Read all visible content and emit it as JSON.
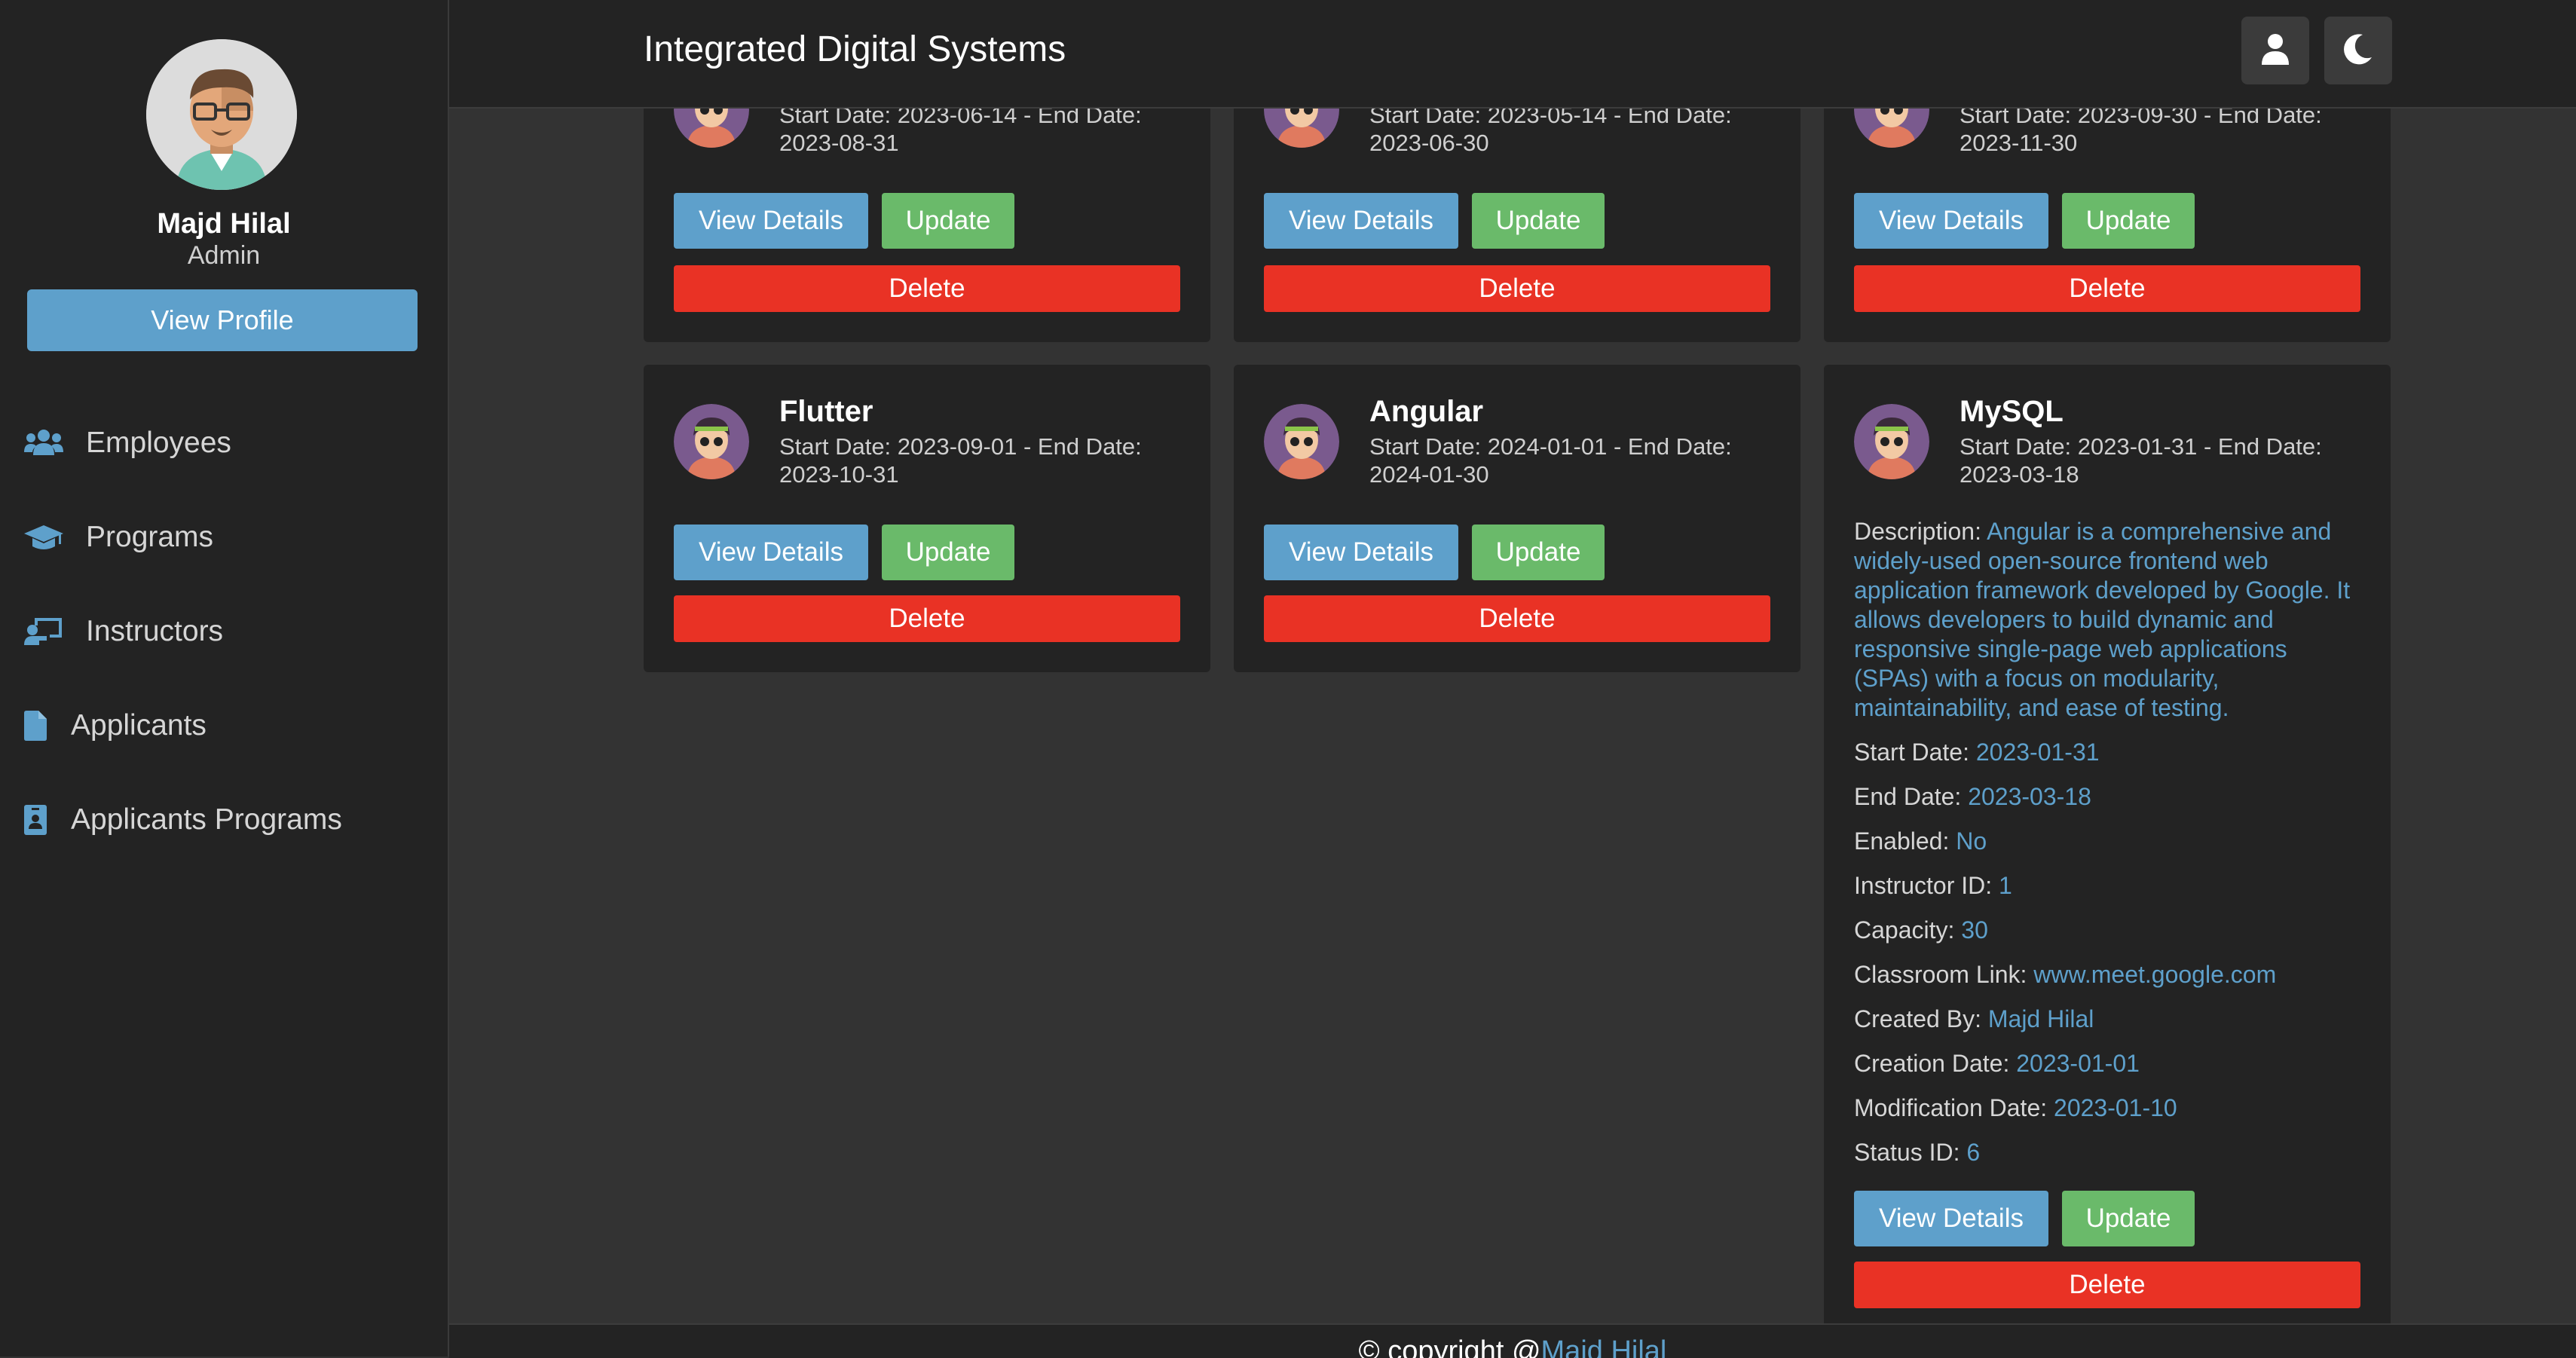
{
  "sidebar": {
    "user_name": "Majd Hilal",
    "user_role": "Admin",
    "view_profile_label": "View Profile",
    "items": [
      {
        "label": "Employees",
        "icon": "users-icon"
      },
      {
        "label": "Programs",
        "icon": "graduation-cap-icon"
      },
      {
        "label": "Instructors",
        "icon": "chalkboard-teacher-icon"
      },
      {
        "label": "Applicants",
        "icon": "file-icon"
      },
      {
        "label": "Applicants Programs",
        "icon": "id-badge-icon"
      }
    ]
  },
  "header": {
    "title": "Integrated Digital Systems",
    "icons": [
      "user-icon",
      "moon-icon"
    ]
  },
  "buttons": {
    "view_details": "View Details",
    "update": "Update",
    "delete": "Delete"
  },
  "cards_top": [
    {
      "dates_line1": "Start Date: 2023-06-14 - End Date:",
      "dates_line2": "2023-08-31"
    },
    {
      "dates_line1": "Start Date: 2023-05-14 - End Date:",
      "dates_line2": "2023-06-30"
    },
    {
      "dates_line1": "Start Date: 2023-09-30 - End Date:",
      "dates_line2": "2023-11-30"
    }
  ],
  "cards_bottom": [
    {
      "title": "Flutter",
      "dates_line1": "Start Date: 2023-09-01 - End Date:",
      "dates_line2": "2023-10-31"
    },
    {
      "title": "Angular",
      "dates_line1": "Start Date: 2024-01-01 - End Date:",
      "dates_line2": "2024-01-30"
    },
    {
      "title": "MySQL",
      "dates_line1": "Start Date: 2023-01-31 - End Date:",
      "dates_line2": "2023-03-18"
    }
  ],
  "details": {
    "description_label": "Description:",
    "description": "Angular is a comprehensive and widely-used open-source frontend web application framework developed by Google. It allows developers to build dynamic and responsive single-page web applications (SPAs) with a focus on modularity, maintainability, and ease of testing.",
    "fields": [
      {
        "label": "Start Date:",
        "value": "2023-01-31"
      },
      {
        "label": "End Date:",
        "value": "2023-03-18"
      },
      {
        "label": "Enabled:",
        "value": "No"
      },
      {
        "label": "Instructor ID:",
        "value": "1"
      },
      {
        "label": "Capacity:",
        "value": "30"
      },
      {
        "label": "Classroom Link:",
        "value": "www.meet.google.com"
      },
      {
        "label": "Created By:",
        "value": "Majd Hilal"
      },
      {
        "label": "Creation Date:",
        "value": "2023-01-01"
      },
      {
        "label": "Modification Date:",
        "value": "2023-01-10"
      },
      {
        "label": "Status ID:",
        "value": "6"
      }
    ]
  },
  "footer": {
    "prefix": "© copyright @",
    "link": "Majd Hilal"
  },
  "colors": {
    "accent": "#5ea0cb",
    "update": "#6aba6a",
    "delete": "#e93225",
    "panel": "#232323",
    "background": "#333333"
  }
}
